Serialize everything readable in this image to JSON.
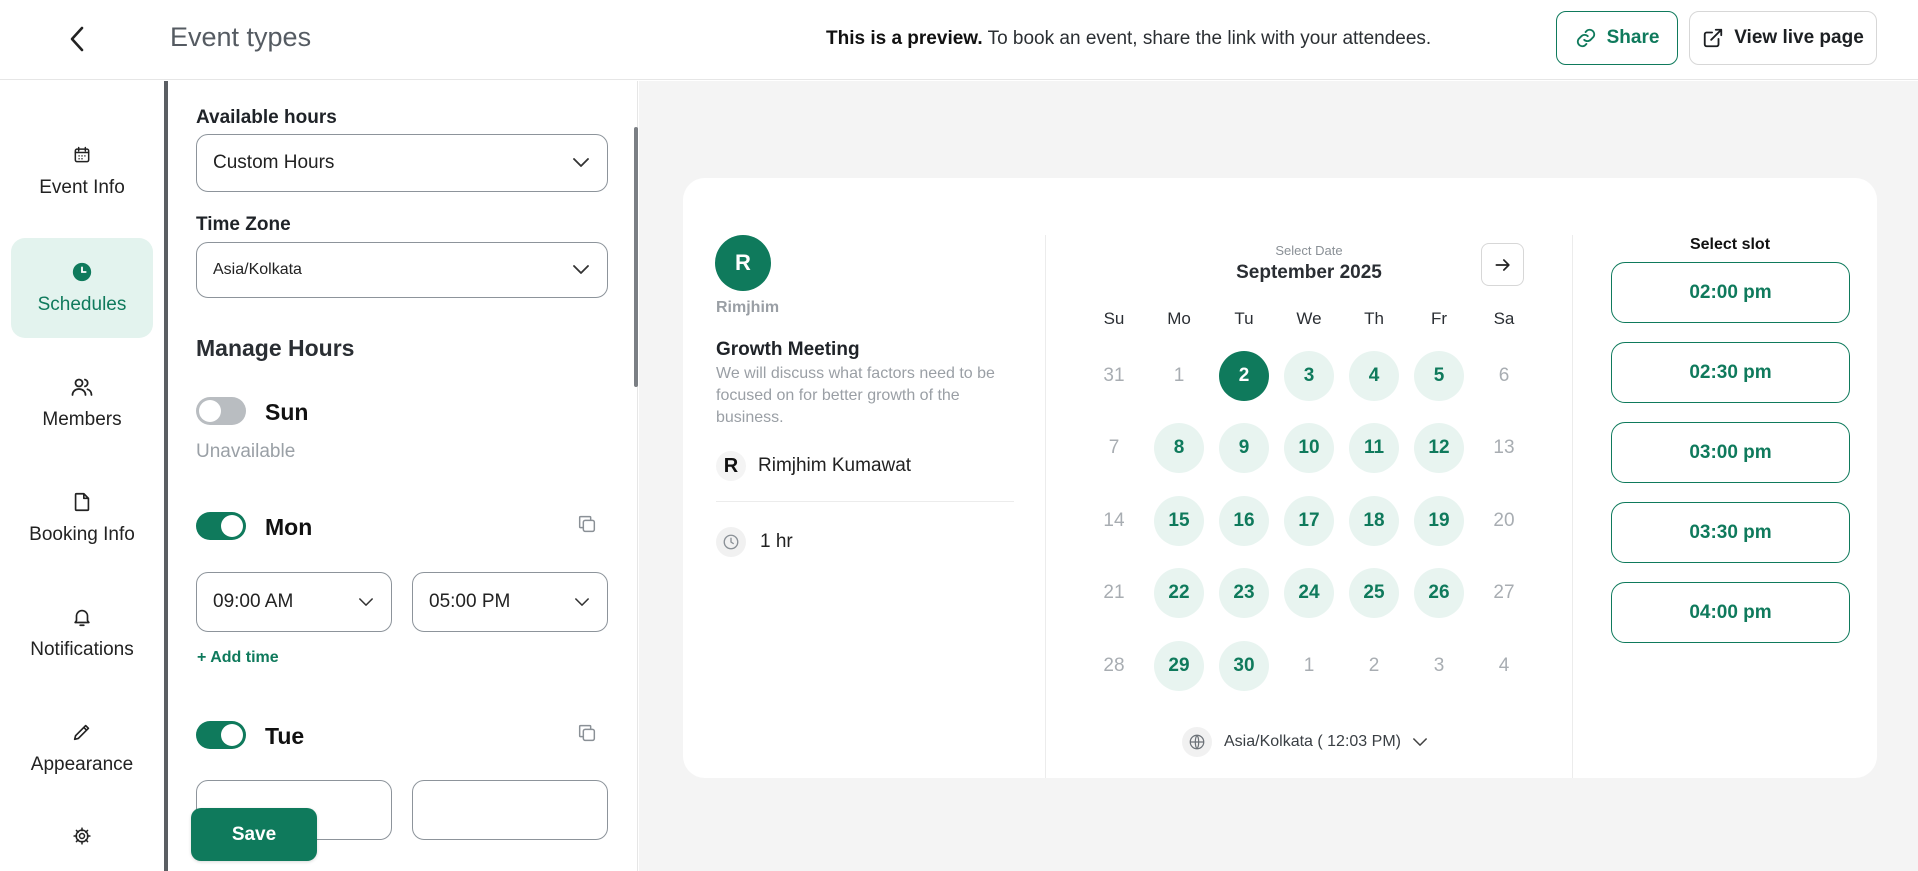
{
  "header": {
    "title": "Event types",
    "preview_bold": "This is a preview.",
    "preview_rest": " To book an event, share the link with your attendees.",
    "share_label": "Share",
    "live_label": "View live page"
  },
  "sidebar": {
    "items": [
      {
        "label": "Event Info",
        "icon": "calendar-icon"
      },
      {
        "label": "Schedules",
        "icon": "clock-icon",
        "active": true
      },
      {
        "label": "Members",
        "icon": "users-icon"
      },
      {
        "label": "Booking Info",
        "icon": "file-icon"
      },
      {
        "label": "Notifications",
        "icon": "bell-icon"
      },
      {
        "label": "Appearance",
        "icon": "pencil-icon"
      },
      {
        "label": "",
        "icon": "gear-icon"
      }
    ]
  },
  "panel": {
    "available_hours_label": "Available hours",
    "available_hours_value": "Custom Hours",
    "timezone_label": "Time Zone",
    "timezone_value": "Asia/Kolkata",
    "manage_hours_title": "Manage Hours",
    "days": [
      {
        "name": "Sun",
        "enabled": false,
        "unavailable_text": "Unavailable"
      },
      {
        "name": "Mon",
        "enabled": true,
        "start": "09:00 AM",
        "end": "05:00 PM",
        "add_time": "+ Add time"
      },
      {
        "name": "Tue",
        "enabled": true
      }
    ],
    "save_label": "Save"
  },
  "preview": {
    "host_initial": "R",
    "host_name": "Rimjhim",
    "event_title": "Growth Meeting",
    "event_description": "We will discuss what factors need to be focused on for better growth of the business.",
    "member_initial": "R",
    "member_name": "Rimjhim Kumawat",
    "duration": "1 hr",
    "calendar": {
      "caption": "Select Date",
      "month": "September 2025",
      "weekdays": [
        "Su",
        "Mo",
        "Tu",
        "We",
        "Th",
        "Fr",
        "Sa"
      ],
      "weeks": [
        [
          {
            "d": "31",
            "s": "muted"
          },
          {
            "d": "1",
            "s": "muted"
          },
          {
            "d": "2",
            "s": "selected"
          },
          {
            "d": "3",
            "s": "avail"
          },
          {
            "d": "4",
            "s": "avail"
          },
          {
            "d": "5",
            "s": "avail"
          },
          {
            "d": "6",
            "s": "muted"
          }
        ],
        [
          {
            "d": "7",
            "s": "muted"
          },
          {
            "d": "8",
            "s": "avail"
          },
          {
            "d": "9",
            "s": "avail"
          },
          {
            "d": "10",
            "s": "avail"
          },
          {
            "d": "11",
            "s": "avail"
          },
          {
            "d": "12",
            "s": "avail"
          },
          {
            "d": "13",
            "s": "muted"
          }
        ],
        [
          {
            "d": "14",
            "s": "muted"
          },
          {
            "d": "15",
            "s": "avail"
          },
          {
            "d": "16",
            "s": "avail"
          },
          {
            "d": "17",
            "s": "avail"
          },
          {
            "d": "18",
            "s": "avail"
          },
          {
            "d": "19",
            "s": "avail"
          },
          {
            "d": "20",
            "s": "muted"
          }
        ],
        [
          {
            "d": "21",
            "s": "muted"
          },
          {
            "d": "22",
            "s": "avail"
          },
          {
            "d": "23",
            "s": "avail"
          },
          {
            "d": "24",
            "s": "avail"
          },
          {
            "d": "25",
            "s": "avail"
          },
          {
            "d": "26",
            "s": "avail"
          },
          {
            "d": "27",
            "s": "muted"
          }
        ],
        [
          {
            "d": "28",
            "s": "muted"
          },
          {
            "d": "29",
            "s": "avail"
          },
          {
            "d": "30",
            "s": "avail"
          },
          {
            "d": "1",
            "s": "muted"
          },
          {
            "d": "2",
            "s": "muted"
          },
          {
            "d": "3",
            "s": "muted"
          },
          {
            "d": "4",
            "s": "muted"
          }
        ]
      ],
      "timezone": "Asia/Kolkata ( 12:03 PM)"
    },
    "slot_title": "Select slot",
    "slots": [
      "02:00 pm",
      "02:30 pm",
      "03:00 pm",
      "03:30 pm",
      "04:00 pm"
    ]
  },
  "colors": {
    "brand": "#0f7a5c",
    "brand_light": "#e8f4f0",
    "active_nav_bg": "#e3f3ee",
    "preview_bg": "#f4f4f4"
  }
}
